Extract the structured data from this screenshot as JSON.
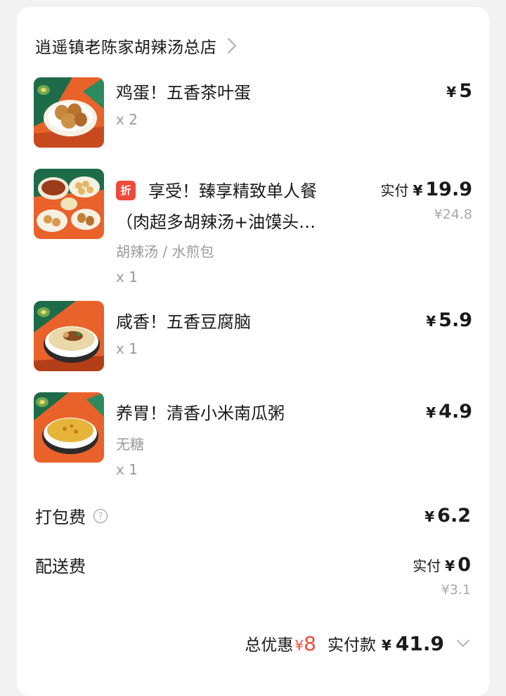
{
  "store": {
    "name": "逍遥镇老陈家胡辣汤总店"
  },
  "items": [
    {
      "name": "鸡蛋！五香茶叶蛋",
      "qty": "x 2",
      "yen": "¥",
      "price": "5"
    },
    {
      "tag": "折",
      "name_line1": "享受！臻享精致单人餐",
      "name_line2": "（肉超多胡辣汤+油馍头…",
      "sub": "胡辣汤 / 水煎包",
      "qty": "x 1",
      "price_label": "实付",
      "yen": "¥",
      "price": "19.9",
      "original_price": "¥24.8"
    },
    {
      "name": "咸香！五香豆腐脑",
      "qty": "x 1",
      "yen": "¥",
      "price": "5.9"
    },
    {
      "name": "养胃！清香小米南瓜粥",
      "sub": "无糖",
      "qty": "x 1",
      "yen": "¥",
      "price": "4.9"
    }
  ],
  "packing_fee": {
    "label": "打包费",
    "yen": "¥",
    "value": "6.2"
  },
  "delivery_fee": {
    "label": "配送费",
    "price_label": "实付",
    "yen": "¥",
    "value": "0",
    "original": "¥3.1"
  },
  "summary": {
    "discount_label": "总优惠",
    "discount_yen": "¥",
    "discount_value": "8",
    "paid_label": "实付款",
    "paid_yen": "¥",
    "paid_value": "41.9"
  },
  "colors": {
    "accent_red": "#ef4b3a",
    "text": "#1a1a1a",
    "muted": "#9a9a9a",
    "background": "#f2f2f2"
  },
  "icons": [
    "chevron-right-icon",
    "help-icon",
    "chevron-down-icon"
  ]
}
